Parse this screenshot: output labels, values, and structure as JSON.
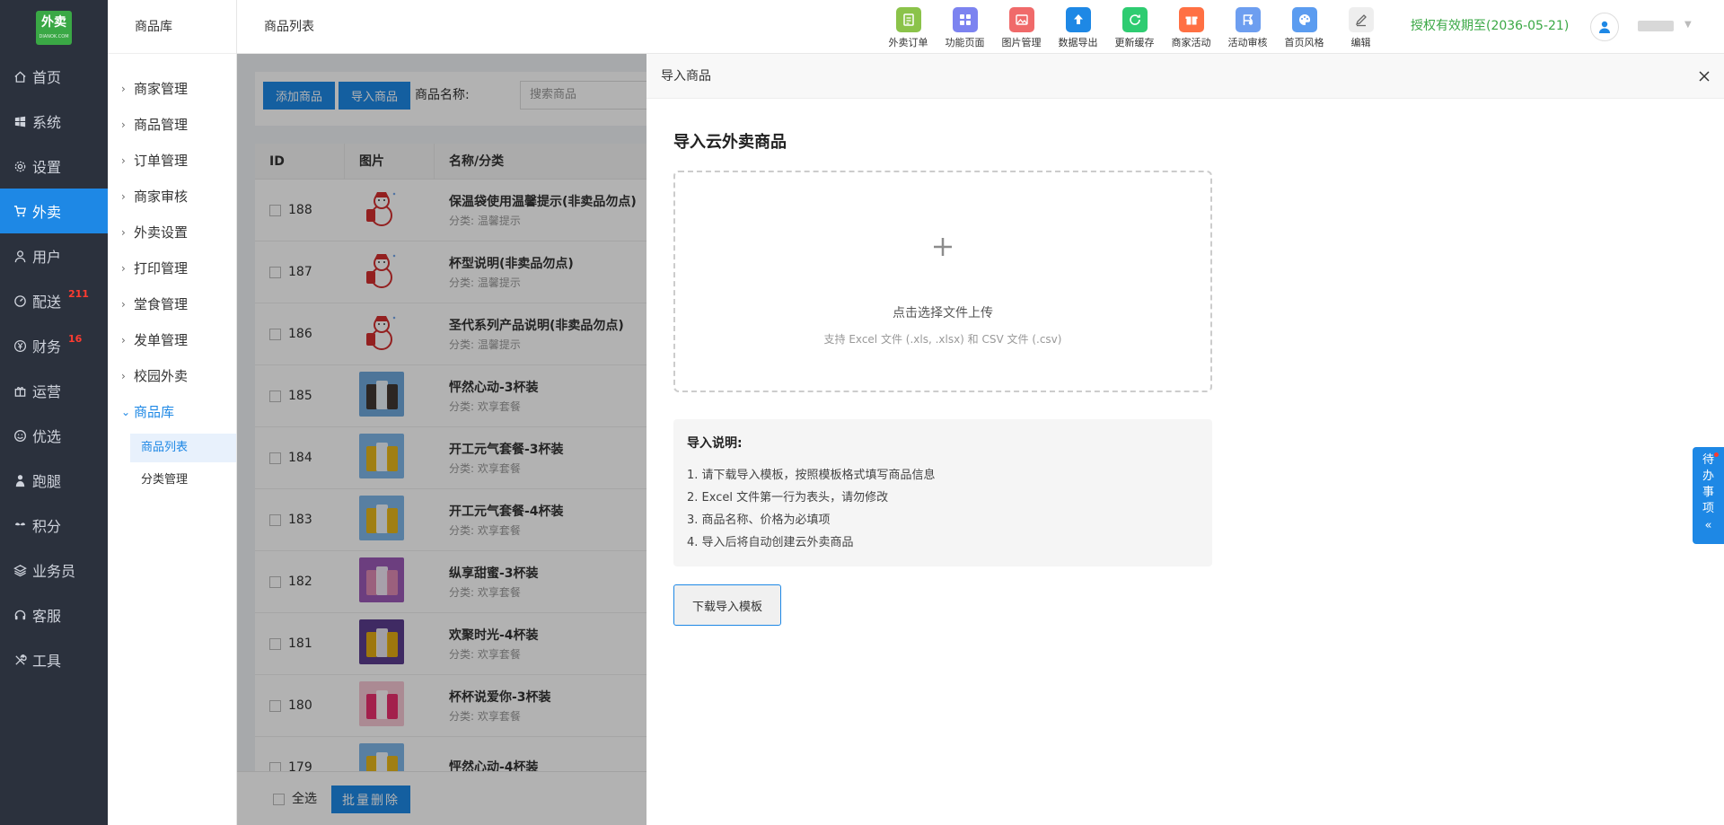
{
  "logo": {
    "main": "外卖",
    "sub": "DIANOK.COM"
  },
  "nav1": [
    {
      "label": "首页",
      "icon": "home-icon"
    },
    {
      "label": "系统",
      "icon": "windows-icon"
    },
    {
      "label": "设置",
      "icon": "gear-icon"
    },
    {
      "label": "外卖",
      "icon": "cart-icon",
      "active": true
    },
    {
      "label": "用户",
      "icon": "user-icon"
    },
    {
      "label": "配送",
      "icon": "gauge-icon",
      "badge": "211"
    },
    {
      "label": "财务",
      "icon": "yen-icon",
      "badge": "16"
    },
    {
      "label": "运营",
      "icon": "gift-icon"
    },
    {
      "label": "优选",
      "icon": "smile-icon"
    },
    {
      "label": "跑腿",
      "icon": "person-icon"
    },
    {
      "label": "积分",
      "icon": "sprout-icon"
    },
    {
      "label": "业务员",
      "icon": "layers-icon"
    },
    {
      "label": "客服",
      "icon": "headset-icon"
    },
    {
      "label": "工具",
      "icon": "tools-icon"
    }
  ],
  "nav2": {
    "title": "商品库",
    "items": [
      "商家管理",
      "商品管理",
      "订单管理",
      "商家审核",
      "外卖设置",
      "打印管理",
      "堂食管理",
      "发单管理",
      "校园外卖"
    ],
    "open_item": "商品库",
    "subs": [
      "商品列表",
      "分类管理"
    ]
  },
  "header": {
    "breadcrumb": "商品列表",
    "tools": [
      {
        "label": "外卖订单",
        "icon": "order-icon",
        "color": "#8bc34a"
      },
      {
        "label": "功能页面",
        "icon": "grid-icon",
        "color": "#7c83f0"
      },
      {
        "label": "图片管理",
        "icon": "image-icon",
        "color": "#f06a6a"
      },
      {
        "label": "数据导出",
        "icon": "upload-icon",
        "color": "#1e88e5"
      },
      {
        "label": "更新缓存",
        "icon": "refresh-icon",
        "color": "#2ecc71"
      },
      {
        "label": "商家活动",
        "icon": "gift-icon",
        "color": "#ff7043"
      },
      {
        "label": "活动审核",
        "icon": "flag-icon",
        "color": "#6d9ef0"
      },
      {
        "label": "首页风格",
        "icon": "palette-icon",
        "color": "#5b9cf0"
      },
      {
        "label": "编辑",
        "icon": "pencil-icon",
        "color": "#eeeeee"
      }
    ],
    "license": "授权有效期至(2036-05-21)"
  },
  "content": {
    "add_button": "添加商品",
    "import_button": "导入商品",
    "name_label": "商品名称:",
    "search_placeholder": "搜索商品",
    "columns": [
      "ID",
      "图片",
      "名称/分类"
    ],
    "rows": [
      {
        "id": "188",
        "name": "保温袋使用温馨提示(非卖品勿点)",
        "cat": "分类: 温馨提示",
        "thumb": "snowman"
      },
      {
        "id": "187",
        "name": "杯型说明(非卖品勿点)",
        "cat": "分类: 温馨提示",
        "thumb": "snowman"
      },
      {
        "id": "186",
        "name": "圣代系列产品说明(非卖品勿点)",
        "cat": "分类: 温馨提示",
        "thumb": "snowman"
      },
      {
        "id": "185",
        "name": "怦然心动-3杯装",
        "cat": "分类: 欢享套餐",
        "thumb": "drink-blue"
      },
      {
        "id": "184",
        "name": "开工元气套餐-3杯装",
        "cat": "分类: 欢享套餐",
        "thumb": "drink-yellow"
      },
      {
        "id": "183",
        "name": "开工元气套餐-4杯装",
        "cat": "分类: 欢享套餐",
        "thumb": "drink-yellow"
      },
      {
        "id": "182",
        "name": "纵享甜蜜-3杯装",
        "cat": "分类: 欢享套餐",
        "thumb": "drink-purple"
      },
      {
        "id": "181",
        "name": "欢聚时光-4杯装",
        "cat": "分类: 欢享套餐",
        "thumb": "drink-purple2"
      },
      {
        "id": "180",
        "name": "杯杯说爱你-3杯装",
        "cat": "分类: 欢享套餐",
        "thumb": "drink-pink"
      },
      {
        "id": "179",
        "name": "怦然心动-4杯装",
        "cat": "",
        "thumb": "drink-yellow"
      }
    ],
    "select_all": "全选",
    "batch_delete": "批量删除"
  },
  "drawer": {
    "header_title": "导入商品",
    "title": "导入云外卖商品",
    "upload_main": "点击选择文件上传",
    "upload_sub": "支持 Excel 文件 (.xls, .xlsx) 和 CSV 文件 (.csv)",
    "notes_title": "导入说明:",
    "notes": [
      "1. 请下载导入模板，按照模板格式填写商品信息",
      "2. Excel 文件第一行为表头，请勿修改",
      "3. 商品名称、价格为必填项",
      "4. 导入后将自动创建云外卖商品"
    ],
    "download_button": "下载导入模板"
  },
  "todo": {
    "chars": [
      "待",
      "办",
      "事",
      "项"
    ]
  },
  "colors": {
    "primary": "#1e88e5",
    "sidebar": "#2b313d",
    "brand_green": "#3aa845",
    "badge_red": "#ff3b30"
  }
}
